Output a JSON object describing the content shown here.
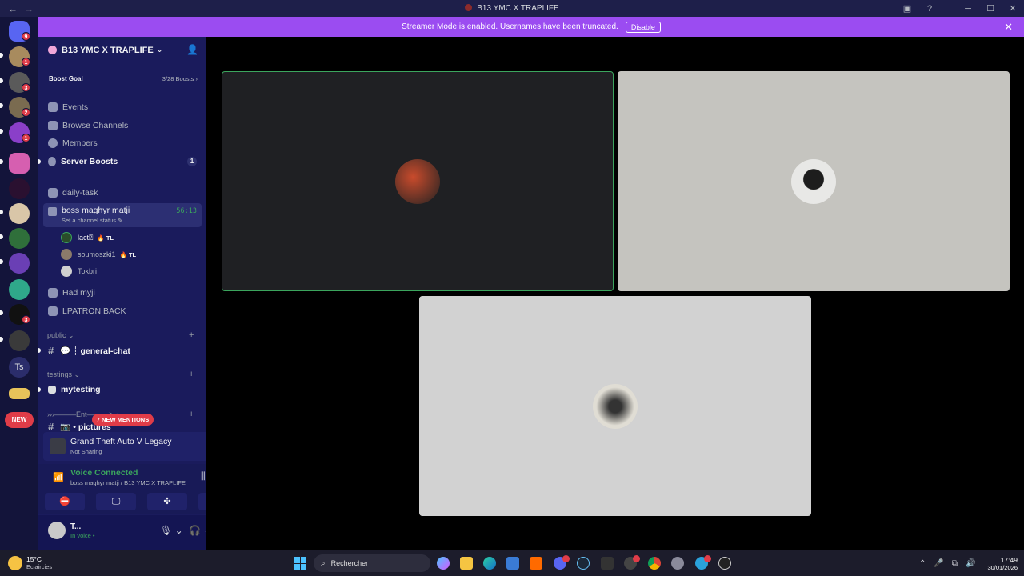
{
  "window": {
    "title": "B13 YMC X TRAPLIFE",
    "back": "←",
    "forward": "→",
    "inbox_icon": "inbox-icon",
    "help": "?",
    "minimize": "─",
    "maximize": "☐",
    "close": "✕"
  },
  "rail": {
    "badges": [
      "9",
      "1",
      "3",
      "2",
      "1",
      "3"
    ],
    "ts_label": "Ts",
    "new_label": "NEW"
  },
  "banner": {
    "text": "Streamer Mode is enabled. Usernames have been truncated.",
    "disable_label": "Disable",
    "close": "✕"
  },
  "server": {
    "name": "B13 YMC X TRAPLIFE",
    "chevron": "⌄",
    "invite_icon": "👤",
    "boost_goal": "Boost Goal",
    "boost_count": "3/28 Boosts ›"
  },
  "nav": {
    "events": "Events",
    "browse": "Browse Channels",
    "members": "Members",
    "boosts": "Server Boosts",
    "boosts_count": "1"
  },
  "channels": {
    "daily": "daily-task",
    "voice_active": {
      "name": "boss maghyr matji",
      "status": "Set a channel status ✎",
      "timer": "56:13"
    },
    "members": [
      {
        "name": "lact⍰",
        "tag": "🔥 TL"
      },
      {
        "name": "soumoszki1",
        "tag": "🔥 TL"
      },
      {
        "name": "Tokbri",
        "tag": ""
      }
    ],
    "had": "Had myji",
    "lpatron": "LPATRON BACK",
    "cat_public": "public ⌄",
    "general": "💬 ┆ general-chat",
    "cat_testings": "testings ⌄",
    "mytesting": "mytesting",
    "cat_enter": "›››———Ent———➤ ›",
    "pictures": "📷 • pictures",
    "plus": "+",
    "mentions": "7 NEW MENTIONS"
  },
  "activity": {
    "game": "Grand Theft Auto V Legacy",
    "sub": "Not Sharing"
  },
  "voice": {
    "title": "Voice Connected",
    "sub": "boss maghyr matji / B13 YMC X TRAPLIFE",
    "signal": "📶",
    "wave": "⫼",
    "hang": "☎",
    "tools": [
      "⛔",
      "🖵",
      "✣",
      "✨"
    ]
  },
  "user": {
    "name": "T...",
    "status": "In voice •",
    "mic": "🎙 ⌄",
    "headset": "🎧 ⌄",
    "settings": "⚙"
  },
  "taskbar": {
    "temp": "15°C",
    "weather": "Eclaircies",
    "search": "Rechercher",
    "time": "17:49",
    "date": "30/01/2026",
    "tray": [
      "⌃",
      "🎤",
      "⧉",
      "🔊"
    ]
  },
  "colors": {
    "accent": "#9b4cf1",
    "speaking_border": "#3ba55d",
    "sidebar": "#1a1b5c",
    "rail": "#13143a"
  }
}
